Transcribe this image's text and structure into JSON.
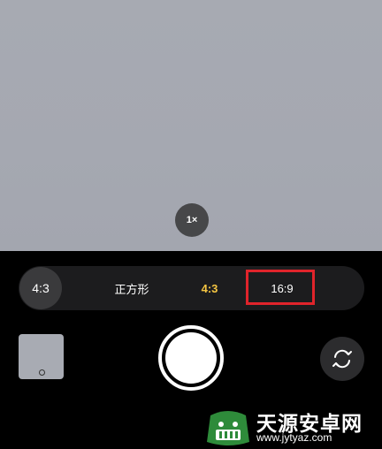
{
  "camera": {
    "zoom_label": "1×",
    "aspect_current": "4:3",
    "aspect_options": [
      "正方形",
      "4:3",
      "16:9"
    ],
    "selected_color": "#f4c542",
    "highlight_color": "#e0242b"
  },
  "icons": {
    "flip": "camera-flip-icon",
    "thumbnail": "photo-thumbnail",
    "shutter": "shutter-button"
  },
  "watermark": {
    "title": "天源安卓网",
    "url": "www.jytyaz.com"
  }
}
